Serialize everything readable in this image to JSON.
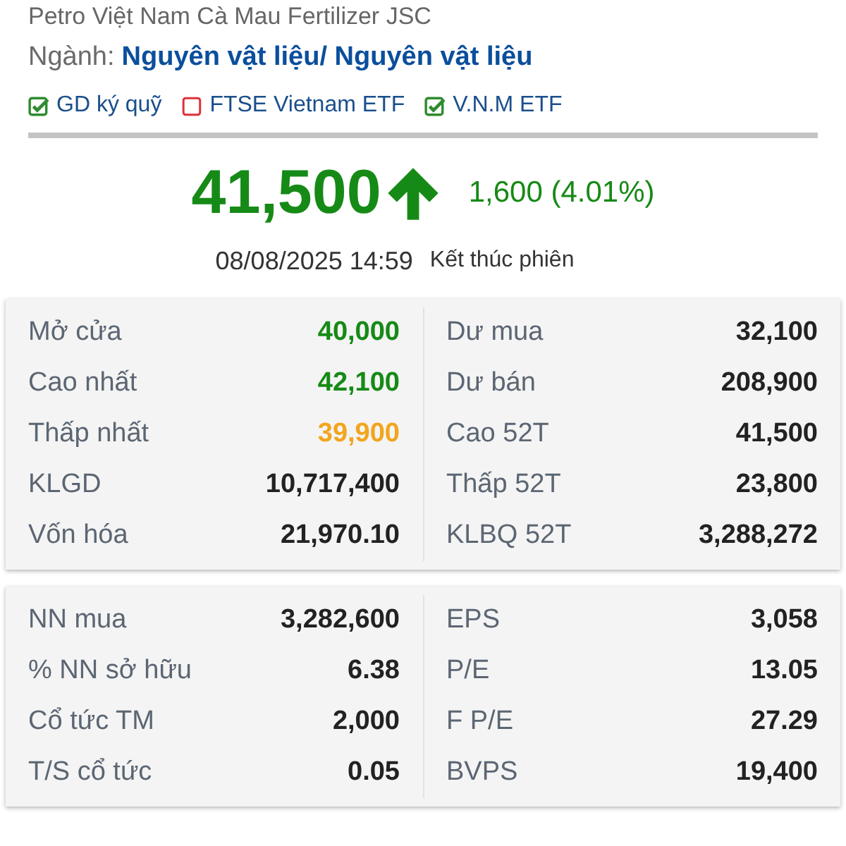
{
  "company_name": "Petro Việt Nam Cà Mau Fertilizer JSC",
  "industry": {
    "label": "Ngành:",
    "value": "Nguyên vật liệu/ Nguyên vật liệu"
  },
  "tags": [
    {
      "label": "GD ký quỹ",
      "checked": true
    },
    {
      "label": "FTSE Vietnam ETF",
      "checked": false
    },
    {
      "label": "V.N.M ETF",
      "checked": true
    }
  ],
  "quote": {
    "price": "41,500",
    "kind": "up",
    "change": "1,600 (4.01%)",
    "datetime": "08/08/2025 14:59",
    "session": "Kết thúc phiên"
  },
  "stat_cards": [
    {
      "left": [
        {
          "label": "Mở cửa",
          "value": "40,000",
          "kind": "up"
        },
        {
          "label": "Cao nhất",
          "value": "42,100",
          "kind": "up"
        },
        {
          "label": "Thấp nhất",
          "value": "39,900",
          "kind": "ref"
        },
        {
          "label": "KLGD",
          "value": "10,717,400",
          "kind": "plain"
        },
        {
          "label": "Vốn hóa",
          "value": "21,970.10",
          "kind": "plain"
        }
      ],
      "right": [
        {
          "label": "Dư mua",
          "value": "32,100",
          "kind": "plain"
        },
        {
          "label": "Dư bán",
          "value": "208,900",
          "kind": "plain"
        },
        {
          "label": "Cao 52T",
          "value": "41,500",
          "kind": "plain"
        },
        {
          "label": "Thấp 52T",
          "value": "23,800",
          "kind": "plain"
        },
        {
          "label": "KLBQ 52T",
          "value": "3,288,272",
          "kind": "plain"
        }
      ]
    },
    {
      "left": [
        {
          "label": "NN mua",
          "value": "3,282,600",
          "kind": "plain"
        },
        {
          "label": "% NN sở hữu",
          "value": "6.38",
          "kind": "plain"
        },
        {
          "label": "Cổ tức TM",
          "value": "2,000",
          "kind": "plain"
        },
        {
          "label": "T/S cổ tức",
          "value": "0.05",
          "kind": "plain"
        }
      ],
      "right": [
        {
          "label": "EPS",
          "value": "3,058",
          "kind": "plain"
        },
        {
          "label": "P/E",
          "value": "13.05",
          "kind": "plain"
        },
        {
          "label": "F P/E",
          "value": "27.29",
          "kind": "plain"
        },
        {
          "label": "BVPS",
          "value": "19,400",
          "kind": "plain"
        }
      ]
    }
  ]
}
